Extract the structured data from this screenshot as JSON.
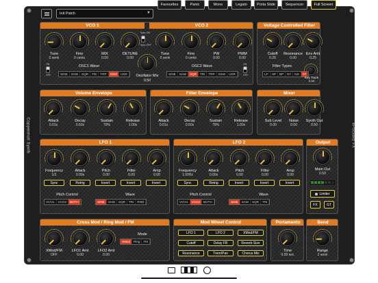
{
  "app": {
    "side_left": "Coppermoll Synth",
    "side_right": "4Pockets FX"
  },
  "topbar": {
    "patch": "Init Patch",
    "buttons": [
      "Favourites",
      "Panic",
      "Mono",
      "Legato",
      "Porta Slide",
      "Sequencer",
      "Full Screen"
    ]
  },
  "vco1": {
    "title": "VCO 1",
    "knobs": [
      {
        "label": "Tune",
        "value": "0 semi"
      },
      {
        "label": "Fine",
        "value": "0 cents"
      },
      {
        "label": "MIX",
        "value": "0.00"
      },
      {
        "label": "DETUNE",
        "value": "0.00"
      }
    ],
    "sync_on": "Sync ON",
    "sync_off": "Sync OFF",
    "wave_label": "OSC1 Wave",
    "waves": [
      "SINE",
      "SAW",
      "SQR",
      "TRI",
      "TRP",
      "SSW",
      "USR"
    ],
    "wave_selected": 5,
    "osc_mix_label": "Oscillator Mix",
    "osc_mix_value": "0.50",
    "on": "ON",
    "off": "OFF"
  },
  "vco2": {
    "title": "VCO 2",
    "knobs": [
      {
        "label": "Tune",
        "value": "0 semi"
      },
      {
        "label": "Fine",
        "value": "0 cents"
      },
      {
        "label": "PW",
        "value": "0.00"
      },
      {
        "label": "PWM",
        "value": "0.00"
      }
    ],
    "wave_label": "OSC2 Wave",
    "waves": [
      "SINE",
      "SAW",
      "SQR",
      "TRI",
      "TRP",
      "SSW",
      "USR"
    ],
    "wave_selected": 2,
    "on": "ON",
    "off": "OFF"
  },
  "vcf": {
    "title": "Voltage Controlled Filter",
    "knobs": [
      {
        "label": "Cutoff",
        "value": "0.25"
      },
      {
        "label": "Resonance",
        "value": "0.00"
      },
      {
        "label": "Env Amt",
        "value": "0.25"
      }
    ],
    "types_label": "Filter Types",
    "types": [
      "LP",
      "HP",
      "BP",
      "NT",
      "NS",
      "FF"
    ],
    "type_selected": 5,
    "keytrack_label": "Key Track",
    "keytrack_value": "0.50"
  },
  "volenv": {
    "title": "Volume Envelope",
    "knobs": [
      {
        "label": "Attack",
        "value": "0.01s"
      },
      {
        "label": "Decay",
        "value": "0.50s"
      },
      {
        "label": "Sustain",
        "value": "70%"
      },
      {
        "label": "Release",
        "value": "1.00s"
      }
    ]
  },
  "filtenv": {
    "title": "Filter Envelope",
    "knobs": [
      {
        "label": "Attack",
        "value": "0.01s"
      },
      {
        "label": "Decay",
        "value": "0.50s"
      },
      {
        "label": "Sustain",
        "value": "70%"
      },
      {
        "label": "Release",
        "value": "1.00s"
      }
    ]
  },
  "mixer": {
    "title": "Mixer",
    "knobs": [
      {
        "label": "Sub Level",
        "value": "0.00"
      },
      {
        "label": "Noise",
        "value": "0.00"
      },
      {
        "label": "Synth Out",
        "value": "0.50"
      }
    ]
  },
  "lfo1": {
    "title": "LFO 1",
    "knobs": [
      {
        "label": "Frequency",
        "value": "1/2"
      },
      {
        "label": "Attack",
        "value": "0.00s"
      },
      {
        "label": "Pitch",
        "value": "0.00"
      },
      {
        "label": "Filter",
        "value": "0.00"
      },
      {
        "label": "Amp",
        "value": "0.00"
      }
    ],
    "buttons": [
      "Sync",
      "Retrig",
      "Invert",
      "Invert",
      "Invert"
    ],
    "pitch_label": "Pitch Control",
    "pitch_opts": [
      "VCO1",
      "VCO2",
      "BOTH"
    ],
    "pitch_selected": 2,
    "wave_label": "Wave",
    "waves": [
      "SINE",
      "SAW",
      "SQR",
      "TRI",
      "RND"
    ],
    "wave_selected": 0
  },
  "lfo2": {
    "title": "LFO 2",
    "knobs": [
      {
        "label": "Frequency",
        "value": "1.00Hz"
      },
      {
        "label": "Attack",
        "value": "0.00s"
      },
      {
        "label": "Pitch",
        "value": "0.00"
      },
      {
        "label": "Filter",
        "value": "0.00"
      },
      {
        "label": "Amp",
        "value": "0.00"
      }
    ],
    "buttons": [
      "Sync",
      "Retrig",
      "Invert",
      "Invert",
      "Invert"
    ],
    "pitch_label": "Pitch Control",
    "pitch_opts": [
      "VCO1",
      "VCO2",
      "BOTH"
    ],
    "pitch_selected": 1,
    "wave_label": "Wave",
    "waves": [
      "SINE",
      "SAW",
      "SQR",
      "TRI"
    ],
    "wave_selected": 0
  },
  "output": {
    "title": "Output",
    "knob": {
      "label": "Main Out",
      "value": "0.50"
    },
    "limiter": "Limiter",
    "fx": "FX",
    "gt": "GT"
  },
  "crossmod": {
    "title": "Cross Mod / Ring Mod / FM",
    "knobs": [
      {
        "label": "XMod/FM",
        "value": "OFF"
      },
      {
        "label": "LFO1 Amt",
        "value": "0.00"
      },
      {
        "label": "LFO2 Amt",
        "value": "0.00"
      }
    ],
    "mode_label": "Mode",
    "modes": [
      "XMod",
      "Ring",
      "FM"
    ],
    "mode_selected": 0
  },
  "modwheel": {
    "title": "Mod Wheel Control",
    "buttons": [
      "LFO 1",
      "LFO 2",
      "XMod/FM",
      "Cutoff",
      "Delay FB",
      "Reverb Size",
      "Resonance",
      "Trem/Pan",
      "Chorus Mix"
    ]
  },
  "porta": {
    "title": "Portamento",
    "knob": {
      "label": "Time",
      "value": "0.00 sec"
    }
  },
  "bend": {
    "title": "Bend",
    "knob": {
      "label": "Range",
      "value": "2 semi"
    }
  }
}
